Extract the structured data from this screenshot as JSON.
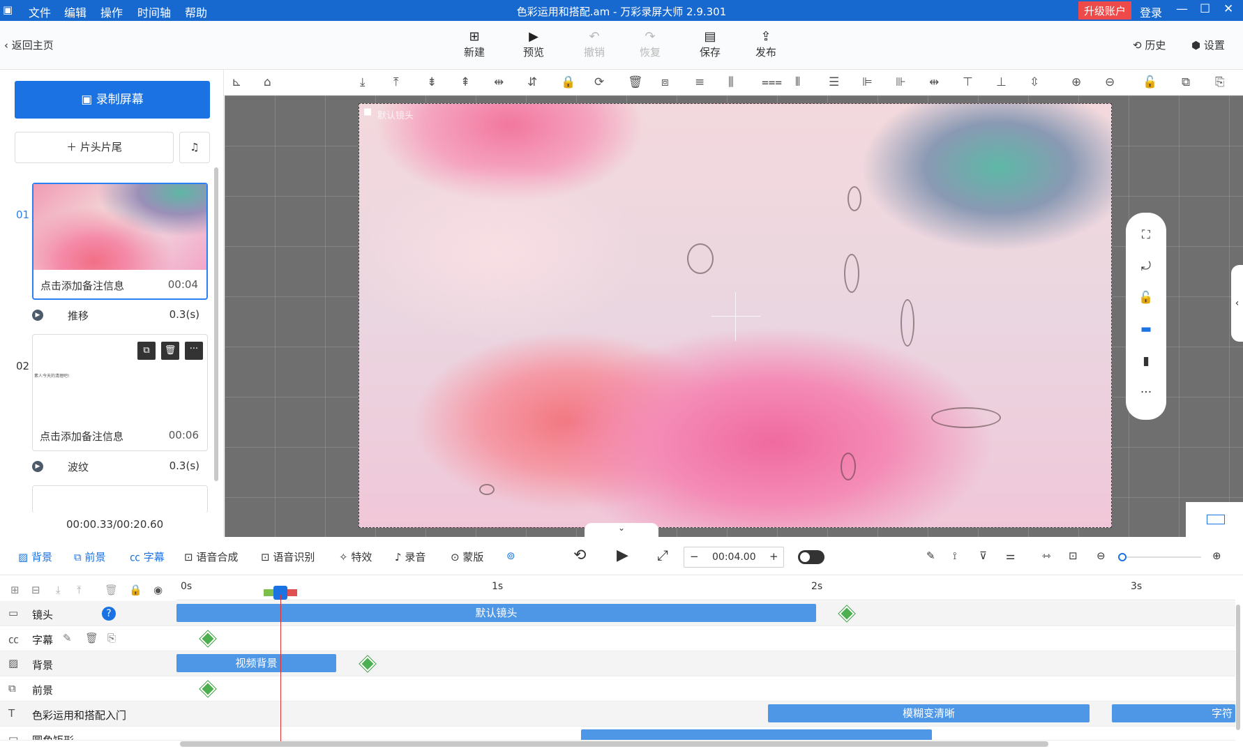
{
  "titlebar": {
    "menu": [
      "文件",
      "编辑",
      "操作",
      "时间轴",
      "帮助"
    ],
    "title": "色彩运用和搭配.am - 万彩录屏大师 2.9.301",
    "upgrade": "升级账户",
    "login": "登录",
    "minimize": "—",
    "maximize": "☐",
    "close": "✕"
  },
  "toolbar": {
    "back": "返回主页",
    "buttons": {
      "new": "新建",
      "preview": "预览",
      "undo": "撤销",
      "redo": "恢复",
      "save": "保存",
      "publish": "发布"
    },
    "history": "历史",
    "settings": "设置"
  },
  "left": {
    "record": "录制屏幕",
    "intro_outro": "片头片尾",
    "scenes": [
      {
        "num": "01",
        "note": "点击添加备注信息",
        "time": "00:04"
      },
      {
        "num": "02",
        "note": "点击添加备注信息",
        "time": "00:06",
        "text": "素人今天的清理吧!"
      }
    ],
    "transitions": [
      {
        "name": "推移",
        "time": "0.3(s)"
      },
      {
        "name": "波纹",
        "time": "0.3(s)"
      }
    ],
    "timecode": "00:00.33/00:20.60"
  },
  "canvas": {
    "camera_label": "默认镜头"
  },
  "bottombar": {
    "tools": [
      "背景",
      "前景",
      "字幕",
      "语音合成",
      "语音识别",
      "特效",
      "录音",
      "蒙版"
    ],
    "time": "00:04.00"
  },
  "timeline": {
    "ticks": [
      "0s",
      "1s",
      "2s",
      "3s"
    ],
    "rows": [
      {
        "label": "镜头",
        "clip": "默认镜头"
      },
      {
        "label": "字幕"
      },
      {
        "label": "背景",
        "clip": "视频背景"
      },
      {
        "label": "前景"
      },
      {
        "label": "色彩运用和搭配入门",
        "clip": "模糊变清晰",
        "clip2": "字符"
      },
      {
        "label": "圆角矩形"
      }
    ]
  }
}
